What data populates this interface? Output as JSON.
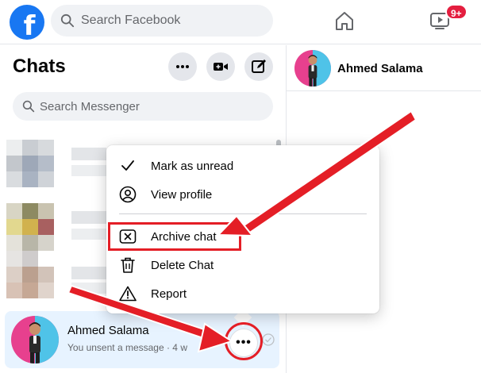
{
  "topbar": {
    "logo_letter": "f",
    "search_placeholder": "Search Facebook",
    "watch_badge": "9+"
  },
  "left": {
    "title": "Chats",
    "search_placeholder": "Search Messenger"
  },
  "chat_row": {
    "name": "Ahmed Salama",
    "subtitle": "You unsent a message · 4 w",
    "more_label": "•••"
  },
  "right": {
    "contact_name": "Ahmed Salama"
  },
  "menu": {
    "items": [
      {
        "label": "Mark as unread",
        "icon": "check-icon"
      },
      {
        "label": "View profile",
        "icon": "profile-icon"
      },
      {
        "label": "Archive chat",
        "icon": "archive-icon"
      },
      {
        "label": "Delete Chat",
        "icon": "trash-icon"
      },
      {
        "label": "Report",
        "icon": "warning-icon"
      }
    ]
  },
  "annotations": {
    "highlight_color": "#e41e26"
  },
  "colors": {
    "brand": "#1877f2",
    "selected_row": "#e7f3ff",
    "badge": "#e41e3f"
  }
}
